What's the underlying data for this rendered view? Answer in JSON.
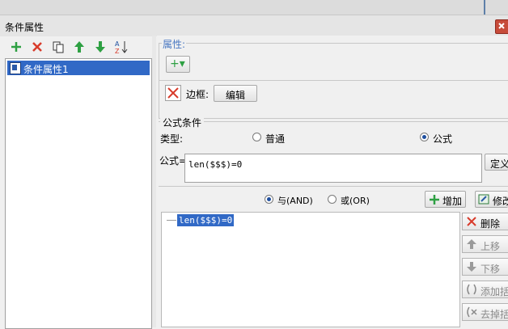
{
  "window": {
    "title": "条件属性"
  },
  "toolbar": {
    "add": "add",
    "delete": "delete",
    "copy": "copy",
    "move_up": "move-up",
    "move_down": "move-down",
    "sort": "sort"
  },
  "tree": {
    "items": [
      {
        "label": "条件属性1",
        "selected": true
      }
    ]
  },
  "properties": {
    "group_label": "属性:",
    "add_button": "+▾",
    "border_label": "边框:",
    "edit_button": "编辑"
  },
  "formula_condition": {
    "group_label": "公式条件",
    "type_label": "类型:",
    "options": [
      {
        "label": "普通",
        "selected": false
      },
      {
        "label": "公式",
        "selected": true
      }
    ],
    "formula_label": "公式=",
    "formula_value": "len($$$)=0",
    "define_button": "定义"
  },
  "logic": {
    "and_label": "与(AND)",
    "and_selected": true,
    "or_label": "或(OR)",
    "or_selected": false,
    "add_button": "增加",
    "modify_button": "修改"
  },
  "conditions_list": {
    "items": [
      {
        "text": "len($$$)=0",
        "selected": true
      }
    ]
  },
  "side_buttons": {
    "delete": "删除",
    "up": "上移",
    "down": "下移",
    "add_bracket": "添加括",
    "remove_bracket": "去掉括"
  },
  "colors": {
    "selection": "#3169c6",
    "add_green": "#2ea043",
    "delete_red": "#d83b2b"
  }
}
